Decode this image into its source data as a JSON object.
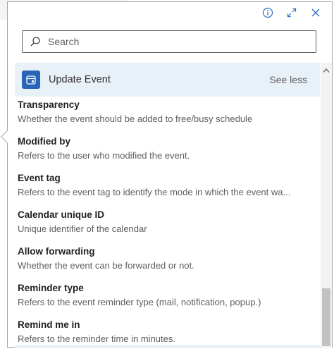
{
  "search": {
    "placeholder": "Search"
  },
  "action": {
    "title": "Update Event",
    "toggle_label": "See less"
  },
  "fields": [
    {
      "title": "Transparency",
      "desc": "Whether the event should be added to free/busy schedule"
    },
    {
      "title": "Modified by",
      "desc": "Refers to the user who modified the event."
    },
    {
      "title": "Event tag",
      "desc": "Refers to the event tag to identify the mode in which the event wa..."
    },
    {
      "title": "Calendar unique ID",
      "desc": "Unique identifier of the calendar"
    },
    {
      "title": "Allow forwarding",
      "desc": "Whether the event can be forwarded or not."
    },
    {
      "title": "Reminder type",
      "desc": "Refers to the event reminder type (mail, notification, popup.)"
    },
    {
      "title": "Remind me in",
      "desc": "Refers to the reminder time in minutes."
    }
  ],
  "icons": {
    "info": "info-icon",
    "expand": "expand-icon",
    "search": "search-icon",
    "action": "calendar-icon",
    "scroll_up": "chevron-up-icon"
  },
  "colors": {
    "accent": "#2864b7",
    "header_bg": "#e8f0f8",
    "icon_blue": "#2e6bc4"
  }
}
